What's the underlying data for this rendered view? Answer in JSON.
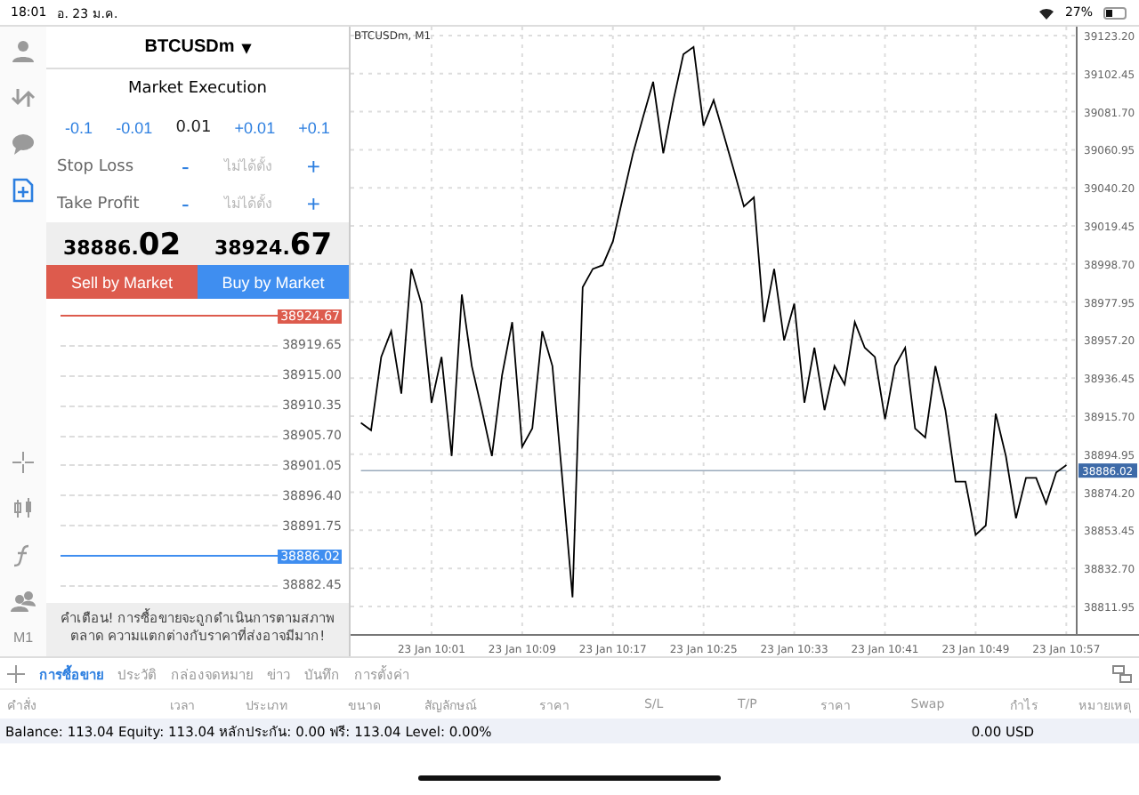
{
  "status_bar": {
    "time": "18:01",
    "date": "อ. 23 ม.ค.",
    "battery": "27%"
  },
  "rail": {
    "top": [
      {
        "selected": false
      },
      {
        "selected": false
      },
      {
        "selected": false
      },
      {
        "selected": true
      }
    ],
    "timeframe": "M1"
  },
  "order": {
    "symbol": "BTCUSDm",
    "symbol_caret": "▾",
    "mode": "Market Execution",
    "lot_steps": [
      {
        "label": "-0.1",
        "kind": "step"
      },
      {
        "label": "-0.01",
        "kind": "step"
      },
      {
        "label": "0.01",
        "kind": "value"
      },
      {
        "label": "+0.01",
        "kind": "step"
      },
      {
        "label": "+0.1",
        "kind": "step"
      }
    ],
    "levels": [
      {
        "label": "Stop Loss",
        "minus": "-",
        "placeholder": "ไม่ได้ตั้ง",
        "plus": "+"
      },
      {
        "label": "Take Profit",
        "minus": "-",
        "placeholder": "ไม่ได้ตั้ง",
        "plus": "+"
      }
    ],
    "bid": {
      "main": "38886.",
      "big": "02"
    },
    "ask": {
      "main": "38924.",
      "big": "67"
    },
    "sell_button": "Sell by Market",
    "buy_button": "Buy by Market",
    "ticks": [
      {
        "label": "38924.67",
        "kind": "ask"
      },
      {
        "label": "38919.65",
        "kind": "tick"
      },
      {
        "label": "38915.00",
        "kind": "tick"
      },
      {
        "label": "38910.35",
        "kind": "tick"
      },
      {
        "label": "38905.70",
        "kind": "tick"
      },
      {
        "label": "38901.05",
        "kind": "tick"
      },
      {
        "label": "38896.40",
        "kind": "tick"
      },
      {
        "label": "38891.75",
        "kind": "tick"
      },
      {
        "label": "38886.02",
        "kind": "bid"
      },
      {
        "label": "38882.45",
        "kind": "tick"
      }
    ],
    "warning": "คำเตือน! การซื้อขายจะถูกดำเนินการตามสภาพตลาด ความแตกต่างกับราคาที่ส่งอาจมีมาก!"
  },
  "chart": {
    "title": "BTCUSDm, M1",
    "price_badge": "38886.02",
    "chart_data": {
      "type": "line",
      "grid": true,
      "categories": [
        null,
        null,
        null,
        null,
        null,
        null,
        null,
        "23 Jan 10:01",
        null,
        null,
        null,
        null,
        null,
        null,
        null,
        null,
        "23 Jan 10:09",
        null,
        null,
        null,
        null,
        null,
        null,
        null,
        null,
        "23 Jan 10:17",
        null,
        null,
        null,
        null,
        null,
        null,
        null,
        null,
        "23 Jan 10:25",
        null,
        null,
        null,
        null,
        null,
        null,
        null,
        null,
        "23 Jan 10:33",
        null,
        null,
        null,
        null,
        null,
        null,
        null,
        null,
        "23 Jan 10:41",
        null,
        null,
        null,
        null,
        null,
        null,
        null,
        null,
        "23 Jan 10:49",
        null,
        null,
        null,
        null,
        null,
        null,
        null,
        null,
        "23 Jan 10:57"
      ],
      "series": [
        {
          "color": "#000000",
          "values": [
            38912,
            38908,
            38948,
            38962,
            38928,
            38996,
            38977,
            38923,
            38948,
            38894,
            38982,
            38943,
            38919,
            38894,
            38938,
            38967,
            38899,
            38909,
            38962,
            38943,
            38880,
            38817,
            38986,
            38996,
            38998,
            39011,
            39035,
            39059,
            39079,
            39098,
            39059,
            39088,
            39113,
            39117,
            39074,
            39088,
            39069,
            39050,
            39030,
            39035,
            38967,
            38996,
            38957,
            38977,
            38923,
            38953,
            38919,
            38943,
            38933,
            38967,
            38953,
            38948,
            38914,
            38943,
            38953,
            38909,
            38904,
            38943,
            38919,
            38880,
            38880,
            38851,
            38856,
            38917,
            38894,
            38860,
            38882,
            38882,
            38868,
            38885,
            38889
          ]
        },
        {
          "color": "#99aabb",
          "values": [
            38886.02,
            38886.02,
            38886.02,
            38886.02,
            38886.02,
            38886.02,
            38886.02,
            38886.02,
            38886.02,
            38886.02,
            38886.02,
            38886.02,
            38886.02,
            38886.02,
            38886.02,
            38886.02,
            38886.02,
            38886.02,
            38886.02,
            38886.02,
            38886.02,
            38886.02,
            38886.02,
            38886.02,
            38886.02,
            38886.02,
            38886.02,
            38886.02,
            38886.02,
            38886.02,
            38886.02,
            38886.02,
            38886.02,
            38886.02,
            38886.02,
            38886.02,
            38886.02,
            38886.02,
            38886.02,
            38886.02,
            38886.02,
            38886.02,
            38886.02,
            38886.02,
            38886.02,
            38886.02,
            38886.02,
            38886.02,
            38886.02,
            38886.02,
            38886.02,
            38886.02,
            38886.02,
            38886.02,
            38886.02,
            38886.02,
            38886.02,
            38886.02,
            38886.02,
            38886.02,
            38886.02,
            38886.02,
            38886.02,
            38886.02,
            38886.02,
            38886.02,
            38886.02,
            38886.02,
            38886.02,
            38886.02,
            38886.02
          ]
        }
      ],
      "ylim": [
        38796.4,
        39128.05
      ],
      "yticks": [
        {
          "value": 39123.2,
          "label": "39123.20"
        },
        {
          "value": 39102.45,
          "label": "39102.45"
        },
        {
          "value": 39081.7,
          "label": "39081.70"
        },
        {
          "value": 39060.95,
          "label": "39060.95"
        },
        {
          "value": 39040.2,
          "label": "39040.20"
        },
        {
          "value": 39019.45,
          "label": "39019.45"
        },
        {
          "value": 38998.7,
          "label": "38998.70"
        },
        {
          "value": 38977.95,
          "label": "38977.95"
        },
        {
          "value": 38957.2,
          "label": "38957.20"
        },
        {
          "value": 38936.45,
          "label": "38936.45"
        },
        {
          "value": 38915.7,
          "label": "38915.70"
        },
        {
          "value": 38894.95,
          "label": "38894.95"
        },
        {
          "value": 38874.2,
          "label": "38874.20"
        },
        {
          "value": 38853.45,
          "label": "38853.45"
        },
        {
          "value": 38832.7,
          "label": "38832.70"
        },
        {
          "value": 38811.95,
          "label": "38811.95"
        }
      ]
    }
  },
  "tabs": [
    {
      "label": "การซื้อขาย",
      "selected": true
    },
    {
      "label": "ประวัติ",
      "selected": false
    },
    {
      "label": "กล่องจดหมาย",
      "selected": false
    },
    {
      "label": "ข่าว",
      "selected": false
    },
    {
      "label": "บันทึก",
      "selected": false
    },
    {
      "label": "การตั้งค่า",
      "selected": false
    }
  ],
  "table": {
    "columns": [
      "คำสั่ง",
      "เวลา",
      "ประเภท",
      "ขนาด",
      "สัญลักษณ์",
      "ราคา",
      "S/L",
      "T/P",
      "ราคา",
      "Swap",
      "กำไร",
      "หมายเหตุ"
    ],
    "summary": "Balance: 113.04 Equity: 113.04 หลักประกัน: 0.00 ฟรี: 113.04 Level: 0.00%",
    "profit": "0.00  USD"
  }
}
